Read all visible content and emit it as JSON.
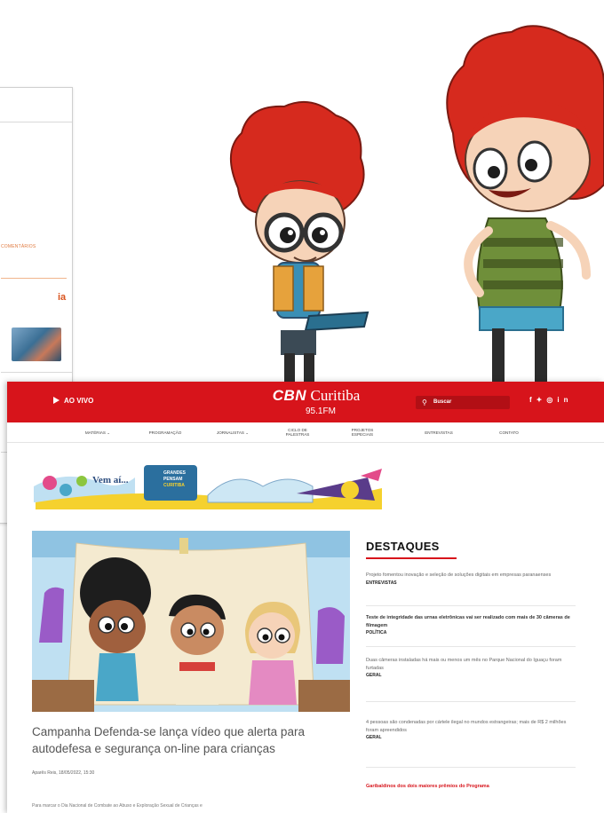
{
  "background_card": {
    "comments_label": "COMENTÁRIOS",
    "section_title_fragment": "ia"
  },
  "cbn": {
    "live_label": "AO VIVO",
    "logo_brand": "CBN",
    "logo_city": "Curitiba",
    "logo_freq": "95.1FM",
    "search_placeholder": "Buscar",
    "social_icons": [
      "facebook-icon",
      "twitter-icon",
      "instagram-icon",
      "linkedin-icon"
    ],
    "nav": [
      {
        "label": "MATÉRIAS ⌄"
      },
      {
        "label": "PROGRAMAÇÃO"
      },
      {
        "label": "JORNALISTAS ⌄"
      },
      {
        "label": "CICLO DE\nPALESTRAS"
      },
      {
        "label": "PROJETOS\nESPECIAIS"
      },
      {
        "label": "ENTREVISTAS"
      },
      {
        "label": "CONTATO"
      }
    ],
    "banner_text": "Vem aí...",
    "banner_logo_text": "GRANDES\nPENSAM\nCURITIBA",
    "article": {
      "title": "Campanha Defenda-se lança vídeo que alerta para autodefesa e segurança on-line para crianças",
      "byline": "Aparês Reis, 18/05/2022, 15:30",
      "lede": "Para marcar o Dia Nacional de Combate ao Abuso e Exploração Sexual de Crianças e"
    },
    "destaques": {
      "heading": "DESTAQUES",
      "items": [
        {
          "title": "Projeto fomentou inovação e seleção de soluções digitais em empresas paranaenses",
          "category": "ENTREVISTAS",
          "style": "normal"
        },
        {
          "title": "Teste de integridade das urnas eletrônicas vai ser realizado com mais de 30 câmeras de filmagem",
          "category": "POLÍTICA",
          "style": "dark"
        },
        {
          "title": "Duas câmeras instaladas há mais ou menos um mês no Parque Nacional do Iguaçu foram furtadas",
          "category": "GERAL",
          "style": "normal"
        },
        {
          "title": "4 pessoas são condenadas por cártele ilegal no mundos estrangeiras; mais de R$ 2 milhões foram apreendidos",
          "category": "GERAL",
          "style": "normal"
        },
        {
          "title": "Garibaldinos dos dois maiores prêmios do Programa",
          "category": "",
          "style": "red"
        }
      ]
    }
  },
  "colors": {
    "brand_red": "#d7141b",
    "nav_text": "#444444",
    "hair_red": "#d62a1e"
  }
}
